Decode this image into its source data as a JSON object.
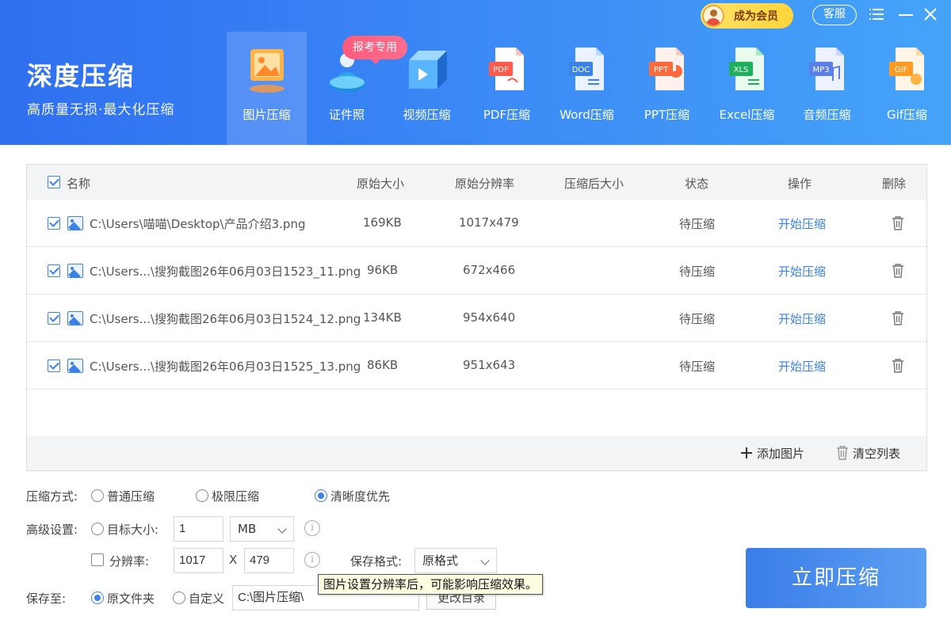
{
  "app": {
    "title": "深度压缩",
    "slogan": "高质量无损·最大化压缩"
  },
  "top": {
    "vip_label": "成为会员",
    "service_label": "客服"
  },
  "badge": {
    "label": "报考专用"
  },
  "tools": [
    {
      "label": "图片压缩",
      "icon": "image-compress-icon",
      "active": true
    },
    {
      "label": "证件照",
      "icon": "id-photo-icon"
    },
    {
      "label": "视频压缩",
      "icon": "video-compress-icon"
    },
    {
      "label": "PDF压缩",
      "icon": "pdf-compress-icon",
      "tag": "PDF"
    },
    {
      "label": "Word压缩",
      "icon": "word-compress-icon",
      "tag": "DOC"
    },
    {
      "label": "PPT压缩",
      "icon": "ppt-compress-icon",
      "tag": "PPT"
    },
    {
      "label": "Excel压缩",
      "icon": "excel-compress-icon",
      "tag": "XLS"
    },
    {
      "label": "音频压缩",
      "icon": "audio-compress-icon",
      "tag": "MP3"
    },
    {
      "label": "Gif压缩",
      "icon": "gif-compress-icon",
      "tag": "GIF"
    }
  ],
  "table": {
    "headers": {
      "name": "名称",
      "orig_size": "原始大小",
      "orig_res": "原始分辨率",
      "new_size": "压缩后大小",
      "status": "状态",
      "action": "操作",
      "delete": "删除"
    },
    "rows": [
      {
        "name": "C:\\Users\\喵喵\\Desktop\\产品介绍3.png",
        "size": "169KB",
        "res": "1017x479",
        "new_size": "",
        "status": "待压缩",
        "action": "开始压缩"
      },
      {
        "name": "C:\\Users...\\搜狗截图26年06月03日1523_11.png",
        "size": "96KB",
        "res": "672x466",
        "new_size": "",
        "status": "待压缩",
        "action": "开始压缩"
      },
      {
        "name": "C:\\Users...\\搜狗截图26年06月03日1524_12.png",
        "size": "134KB",
        "res": "954x640",
        "new_size": "",
        "status": "待压缩",
        "action": "开始压缩"
      },
      {
        "name": "C:\\Users...\\搜狗截图26年06月03日1525_13.png",
        "size": "86KB",
        "res": "951x643",
        "new_size": "",
        "status": "待压缩",
        "action": "开始压缩"
      }
    ],
    "add_label": "添加图片",
    "clear_label": "清空列表"
  },
  "options": {
    "mode_label": "压缩方式:",
    "modes": [
      "普通压缩",
      "极限压缩",
      "清晰度优先"
    ],
    "mode_selected": "清晰度优先",
    "adv_label": "高级设置:",
    "target_label": "目标大小:",
    "target_value": "1",
    "target_unit": "MB",
    "res_label": "分辨率:",
    "res_w": "1017",
    "res_x": "X",
    "res_h": "479",
    "format_label": "保存格式:",
    "format_value": "原格式",
    "save_label": "保存至:",
    "save_orig": "原文件夹",
    "save_custom": "自定义",
    "save_path": "C:\\图片压缩\\",
    "change_dir": "更改目录",
    "tooltip": "图片设置分辨率后，可能影响压缩效果。"
  },
  "go_button": "立即压缩",
  "colors": {
    "accent": "#3b82e6",
    "header_start": "#2f6ff0",
    "header_end": "#45a4f8"
  }
}
